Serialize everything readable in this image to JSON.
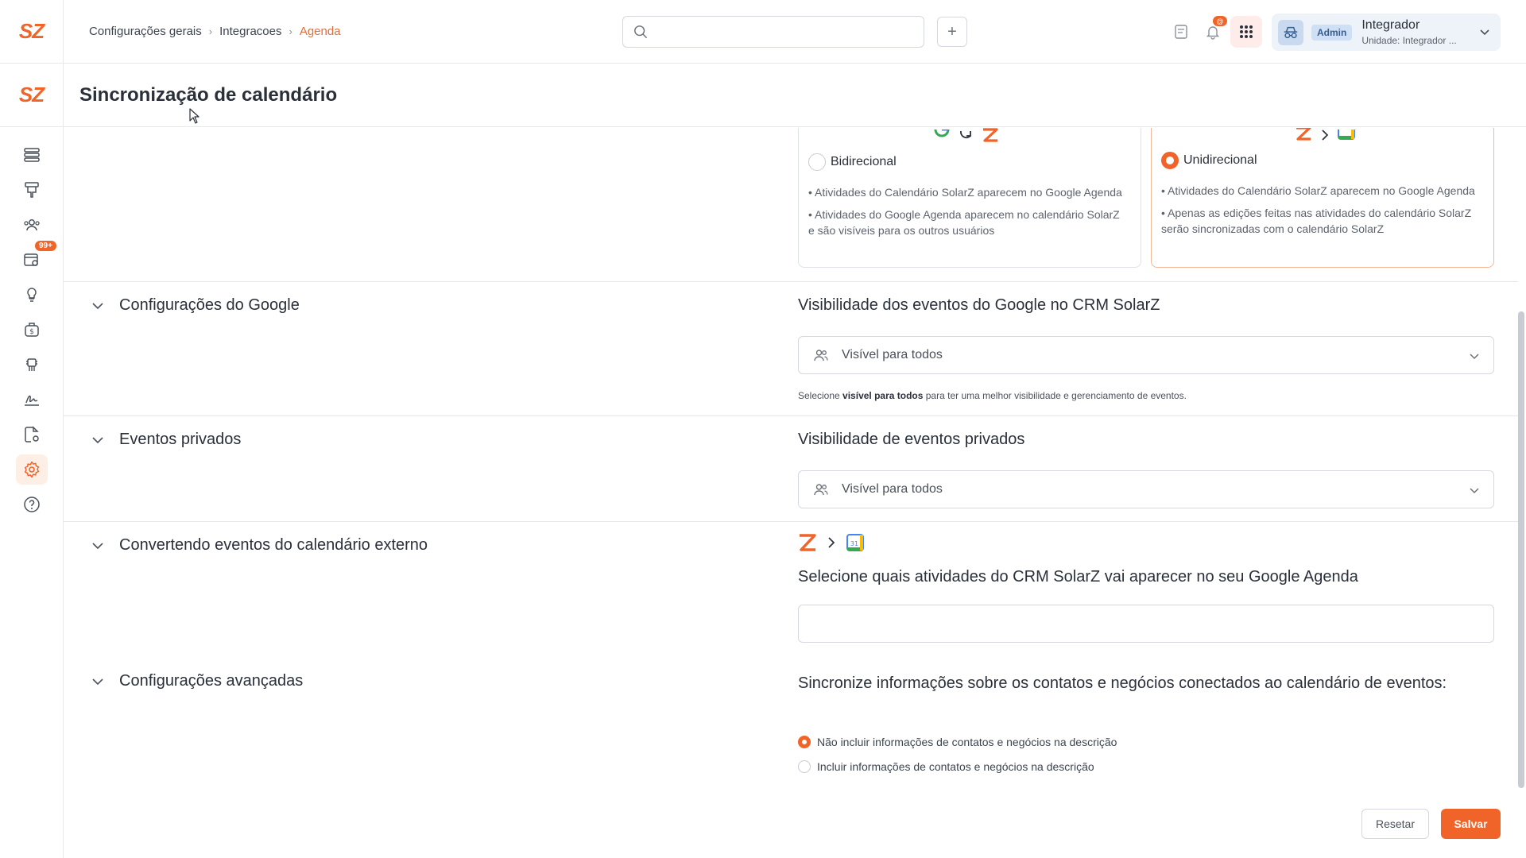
{
  "brand": {
    "logo": "SZ",
    "accent": "#f0642a"
  },
  "header": {
    "breadcrumb": [
      "Configurações gerais",
      "Integracoes",
      "Agenda"
    ],
    "search": {
      "placeholder": "",
      "value": ""
    },
    "add_label": "+",
    "notification_badge": "@",
    "user": {
      "role": "Admin",
      "name": "Integrador",
      "unit": "Unidade: Integrador ..."
    }
  },
  "sidebar": {
    "items": [
      {
        "icon": "list-icon",
        "label": ""
      },
      {
        "icon": "funnel-icon",
        "label": ""
      },
      {
        "icon": "users-icon",
        "label": ""
      },
      {
        "icon": "calendar-search-icon",
        "badge": "99+"
      },
      {
        "icon": "lightbulb-icon",
        "label": ""
      },
      {
        "icon": "money-bag-icon",
        "label": ""
      },
      {
        "icon": "chip-icon",
        "label": ""
      },
      {
        "icon": "signature-icon",
        "label": ""
      },
      {
        "icon": "document-settings-icon",
        "label": ""
      },
      {
        "icon": "gear-icon",
        "active": true
      },
      {
        "icon": "help-icon",
        "label": ""
      }
    ]
  },
  "page": {
    "title": "Sincronização de calendário"
  },
  "sync_modes": [
    {
      "title": "Bidirecional",
      "selected": false,
      "bullets": [
        "• Atividades do Calendário SolarZ aparecem no Google Agenda",
        "• Atividades do Google Agenda aparecem no calendário SolarZ e são visíveis para os outros usuários"
      ]
    },
    {
      "title": "Unidirecional",
      "selected": true,
      "bullets": [
        "• Atividades do Calendário SolarZ aparecem no Google Agenda",
        "• Apenas as edições feitas nas atividades do calendário SolarZ serão sincronizadas com o calendário SolarZ"
      ]
    }
  ],
  "sections": {
    "google": {
      "title": "Configurações do Google",
      "field_label": "Visibilidade dos eventos do Google no CRM SolarZ",
      "select_value": "Visível para todos",
      "helper_prefix": "Selecione ",
      "helper_bold": "visível para todos",
      "helper_suffix": " para ter uma melhor visibilidade e gerenciamento de eventos."
    },
    "private": {
      "title": "Eventos privados",
      "field_label": "Visibilidade de eventos privados",
      "select_value": "Visível para todos"
    },
    "external": {
      "title": "Convertendo eventos do calendário externo",
      "field_label": "Selecione quais atividades do CRM SolarZ vai aparecer no seu Google Agenda",
      "input_value": ""
    },
    "advanced": {
      "title": "Configurações avançadas",
      "field_label": "Sincronize informações sobre os contatos e negócios conectados ao calendário de eventos:",
      "options": [
        {
          "label": "Não incluir informações de contatos e negócios na descrição",
          "selected": true
        },
        {
          "label": "Incluir informações de contatos e negócios na descrição",
          "selected": false
        }
      ]
    }
  },
  "footer": {
    "reset_label": "Resetar",
    "save_label": "Salvar"
  }
}
